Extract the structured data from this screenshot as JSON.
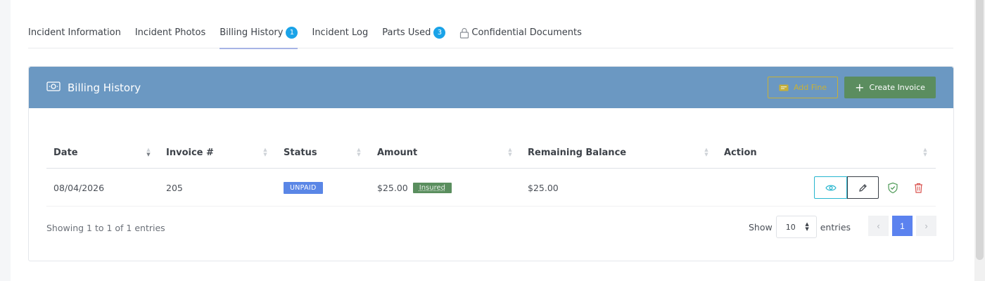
{
  "tabs": [
    {
      "label": "Incident Information"
    },
    {
      "label": "Incident Photos"
    },
    {
      "label": "Billing History",
      "badge": "1"
    },
    {
      "label": "Incident Log"
    },
    {
      "label": "Parts Used",
      "badge": "3"
    },
    {
      "label": "Confidential Documents"
    }
  ],
  "card": {
    "title": "Billing History",
    "add_fine_label": "Add Fine",
    "create_invoice_label": "Create Invoice"
  },
  "table": {
    "headers": {
      "date": "Date",
      "invoice": "Invoice #",
      "status": "Status",
      "amount": "Amount",
      "remaining": "Remaining Balance",
      "action": "Action"
    },
    "rows": [
      {
        "date": "08/04/2026",
        "invoice": "205",
        "status": "UNPAID",
        "amount": "$25.00",
        "insured": "Insured",
        "remaining": "$25.00"
      }
    ]
  },
  "footer": {
    "info": "Showing 1 to 1 of 1 entries",
    "show_label": "Show",
    "page_size": "10",
    "entries_label": "entries",
    "prev": "‹",
    "current_page": "1",
    "next": "›"
  },
  "colors": {
    "header_bg": "#6b98c2",
    "add_fine": "#d8b520",
    "create_invoice": "#5b8d5f",
    "unpaid": "#5a86e6",
    "insured": "#5a8e5e",
    "page_active": "#5b82ef"
  }
}
